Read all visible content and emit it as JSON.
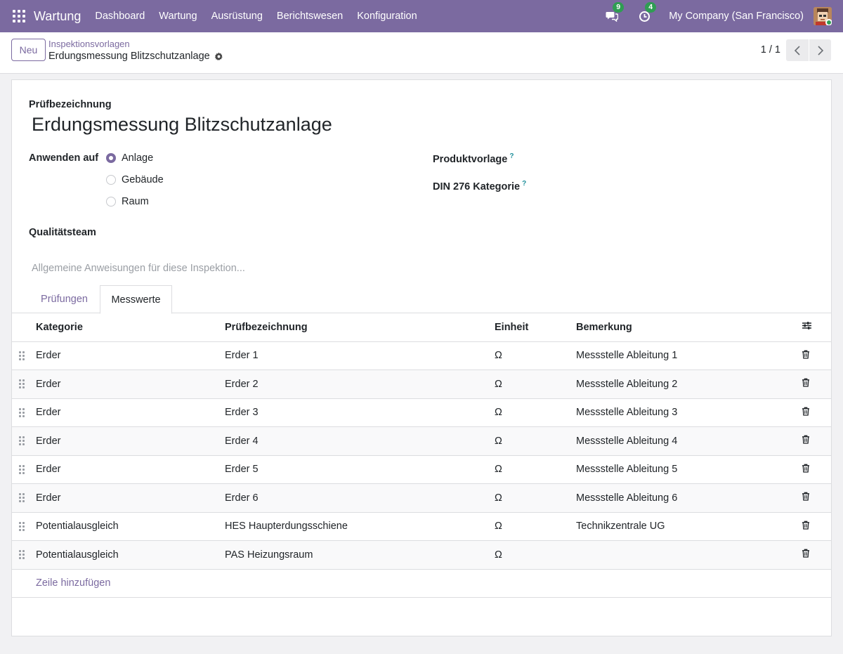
{
  "navbar": {
    "app_name": "Wartung",
    "menu": [
      "Dashboard",
      "Wartung",
      "Ausrüstung",
      "Berichtswesen",
      "Konfiguration"
    ],
    "messages_count": "9",
    "activities_count": "4",
    "company": "My Company (San Francisco)",
    "accent": "#7b6aa0"
  },
  "control": {
    "new_label": "Neu",
    "breadcrumb": "Inspektionsvorlagen",
    "record_name": "Erdungsmessung Blitzschutzanlage",
    "pager": "1 / 1"
  },
  "form": {
    "name_label": "Prüfbezeichnung",
    "name_value": "Erdungsmessung Blitzschutzanlage",
    "apply_label": "Anwenden auf",
    "apply_options": [
      "Anlage",
      "Gebäude",
      "Raum"
    ],
    "apply_selected": "Anlage",
    "product_template_label": "Produktvorlage",
    "din_label": "DIN 276 Kategorie",
    "help_mark": "?",
    "team_label": "Qualitätsteam",
    "instructions_placeholder": "Allgemeine Anweisungen für diese Inspektion..."
  },
  "tabs": [
    "Prüfungen",
    "Messwerte"
  ],
  "active_tab": "Messwerte",
  "table": {
    "headers": [
      "Kategorie",
      "Prüfbezeichnung",
      "Einheit",
      "Bemerkung"
    ],
    "rows": [
      {
        "category": "Erder",
        "name": "Erder 1",
        "unit": "Ω",
        "note": "Messstelle Ableitung 1"
      },
      {
        "category": "Erder",
        "name": "Erder 2",
        "unit": "Ω",
        "note": "Messstelle Ableitung 2"
      },
      {
        "category": "Erder",
        "name": "Erder 3",
        "unit": "Ω",
        "note": "Messstelle Ableitung 3"
      },
      {
        "category": "Erder",
        "name": "Erder 4",
        "unit": "Ω",
        "note": "Messstelle Ableitung 4"
      },
      {
        "category": "Erder",
        "name": "Erder 5",
        "unit": "Ω",
        "note": "Messstelle Ableitung 5"
      },
      {
        "category": "Erder",
        "name": "Erder 6",
        "unit": "Ω",
        "note": "Messstelle Ableitung 6"
      },
      {
        "category": "Potentialausgleich",
        "name": "HES Haupterdungsschiene",
        "unit": "Ω",
        "note": "Technikzentrale UG"
      },
      {
        "category": "Potentialausgleich",
        "name": "PAS Heizungsraum",
        "unit": "Ω",
        "note": ""
      }
    ],
    "add_line": "Zeile hinzufügen"
  }
}
